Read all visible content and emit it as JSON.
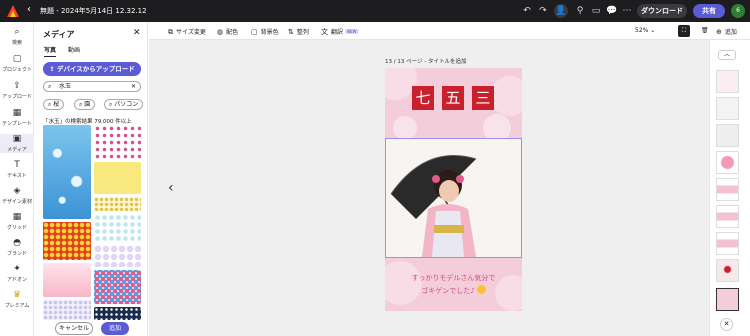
{
  "topbar": {
    "back": "‹",
    "title": "無題 - 2024年5月14日 12.32.12",
    "download": "ダウンロード",
    "share": "共有",
    "avatar": "6"
  },
  "rail": [
    {
      "icon": "⌕",
      "label": "検索"
    },
    {
      "icon": "▢",
      "label": "プロジェクト"
    },
    {
      "icon": "⇪",
      "label": "アップロード"
    },
    {
      "icon": "▦",
      "label": "テンプレート"
    },
    {
      "icon": "▣",
      "label": "メディア"
    },
    {
      "icon": "T",
      "label": "テキスト"
    },
    {
      "icon": "◈",
      "label": "デザイン素材"
    },
    {
      "icon": "▦",
      "label": "グリッド"
    },
    {
      "icon": "◓",
      "label": "ブランド"
    },
    {
      "icon": "✦",
      "label": "アドオン"
    },
    {
      "icon": "♛",
      "label": "プレミアム"
    }
  ],
  "panel": {
    "title": "メディア",
    "close": "✕",
    "tab_photo": "写真",
    "tab_video": "動画",
    "upload": "デバイスからアップロード",
    "search_value": "水玉",
    "search_clear": "✕",
    "chips": [
      "桜",
      "園",
      "パソコン"
    ],
    "result_count": "「水玉」の検索結果 79,000 件以上",
    "cancel": "キャンセル",
    "add": "追加"
  },
  "toolbar": {
    "resize": "サイズ変更",
    "color": "配色",
    "bg": "背景色",
    "arrange": "整列",
    "translate": "翻訳",
    "new": "NEW",
    "zoom": "52%",
    "add": "追加"
  },
  "canvas": {
    "page_label": "13 / 13 ページ - タイトルを追加",
    "kanji": [
      "七",
      "五",
      "三"
    ],
    "caption_line1": "すっかりモデルさん気分で",
    "caption_line2": "ゴキゲンでした♪"
  },
  "colors": {
    "accent": "#5b5bd6",
    "card_pink": "#f4cdda",
    "kanji_red": "#c9202e"
  }
}
